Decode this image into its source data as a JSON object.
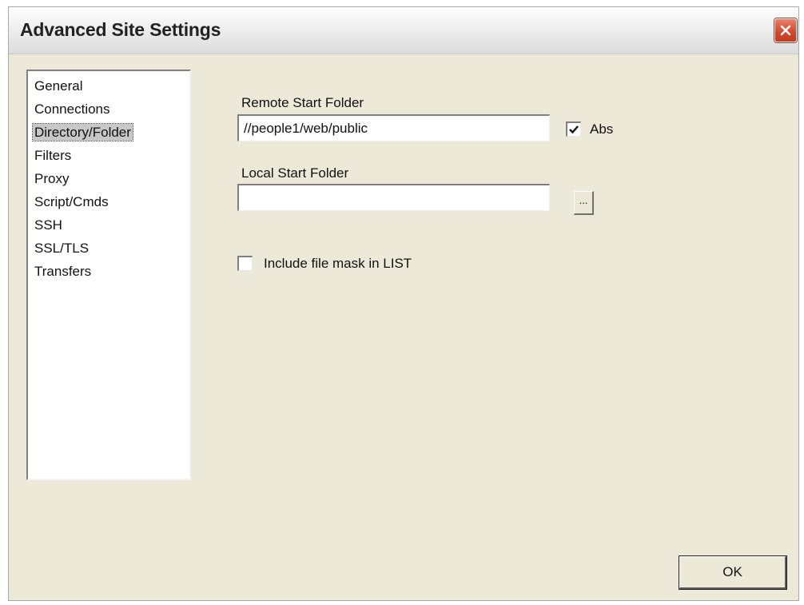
{
  "window": {
    "title": "Advanced Site Settings"
  },
  "sidebar": {
    "items": [
      {
        "label": "General",
        "selected": false
      },
      {
        "label": "Connections",
        "selected": false
      },
      {
        "label": "Directory/Folder",
        "selected": true
      },
      {
        "label": "Filters",
        "selected": false
      },
      {
        "label": "Proxy",
        "selected": false
      },
      {
        "label": "Script/Cmds",
        "selected": false
      },
      {
        "label": "SSH",
        "selected": false
      },
      {
        "label": "SSL/TLS",
        "selected": false
      },
      {
        "label": "Transfers",
        "selected": false
      }
    ]
  },
  "remote_folder": {
    "label": "Remote Start Folder",
    "value": "//people1/web/public",
    "abs_label": "Abs",
    "abs_checked": true
  },
  "local_folder": {
    "label": "Local Start Folder",
    "value": "",
    "browse_label": "..."
  },
  "file_mask": {
    "label": "Include file mask in LIST",
    "checked": false
  },
  "buttons": {
    "ok_label": "OK"
  },
  "icons": {
    "close": "close-icon",
    "check": "checkmark-icon"
  },
  "colors": {
    "close_button": "#d24a2c",
    "dialog_background": "#ece9d8",
    "selection_highlight": "#c7c7c7"
  }
}
